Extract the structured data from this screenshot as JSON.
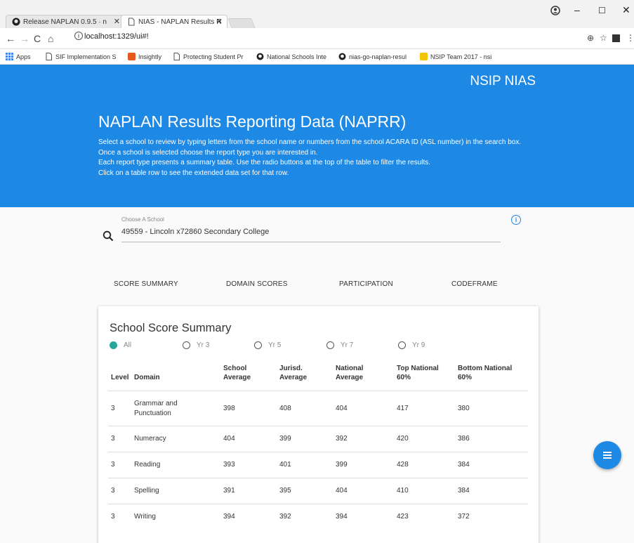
{
  "browser": {
    "tabs": [
      {
        "title": "Release NAPLAN 0.9.5 · n"
      },
      {
        "title": "NIAS - NAPLAN Results R"
      }
    ],
    "url": "localhost:1329/ui#!",
    "bookmarks": [
      {
        "label": "Apps"
      },
      {
        "label": "SIF Implementation S"
      },
      {
        "label": "Insightly"
      },
      {
        "label": "Protecting Student Pr"
      },
      {
        "label": "National Schools Inte"
      },
      {
        "label": "nias-go-naplan-resul"
      },
      {
        "label": "NSIP Team 2017 - nsi"
      }
    ],
    "colors": {
      "insightly": "#e55a1c",
      "nsip": "#f5c400"
    }
  },
  "header": {
    "brand": "NSIP NIAS",
    "title": "NAPLAN Results Reporting Data (NAPRR)",
    "lines": [
      "Select a school to review by typing letters from the school name or numbers from the school ACARA ID (ASL number) in the search box.",
      "Once a school is selected choose the report type you are interested in.",
      "Each report type presents a summary table. Use the radio buttons at the top of the table to filter the results.",
      "Click on a table row to see the extended data set for that row."
    ],
    "color": "#1e88e5"
  },
  "search": {
    "label": "Choose A School",
    "value": "49559 - Lincoln x72860 Secondary College",
    "icon": "search-icon"
  },
  "report_tabs": [
    {
      "label": "SCORE SUMMARY"
    },
    {
      "label": "DOMAIN SCORES"
    },
    {
      "label": "PARTICIPATION"
    },
    {
      "label": "CODEFRAME"
    }
  ],
  "summary": {
    "title": "School Score Summary",
    "filters": [
      {
        "label": "All",
        "selected": true
      },
      {
        "label": "Yr 3",
        "selected": false
      },
      {
        "label": "Yr 5",
        "selected": false
      },
      {
        "label": "Yr 7",
        "selected": false
      },
      {
        "label": "Yr 9",
        "selected": false
      }
    ],
    "columns": [
      {
        "line1": "Level",
        "line2": ""
      },
      {
        "line1": "Domain",
        "line2": ""
      },
      {
        "line1": "School",
        "line2": "Average"
      },
      {
        "line1": "Jurisd.",
        "line2": "Average"
      },
      {
        "line1": "National",
        "line2": "Average"
      },
      {
        "line1": "Top National",
        "line2": "60%"
      },
      {
        "line1": "Bottom National",
        "line2": "60%"
      }
    ],
    "rows": [
      {
        "level": "3",
        "domain1": "Grammar and",
        "domain2": "Punctuation",
        "school": "398",
        "jurisd": "408",
        "national": "404",
        "top": "417",
        "bottom": "380"
      },
      {
        "level": "3",
        "domain1": "Numeracy",
        "domain2": "",
        "school": "404",
        "jurisd": "399",
        "national": "392",
        "top": "420",
        "bottom": "386"
      },
      {
        "level": "3",
        "domain1": "Reading",
        "domain2": "",
        "school": "393",
        "jurisd": "401",
        "national": "399",
        "top": "428",
        "bottom": "384"
      },
      {
        "level": "3",
        "domain1": "Spelling",
        "domain2": "",
        "school": "391",
        "jurisd": "395",
        "national": "404",
        "top": "410",
        "bottom": "384"
      },
      {
        "level": "3",
        "domain1": "Writing",
        "domain2": "",
        "school": "394",
        "jurisd": "392",
        "national": "394",
        "top": "423",
        "bottom": "372"
      }
    ],
    "accent": "#26a69a"
  }
}
